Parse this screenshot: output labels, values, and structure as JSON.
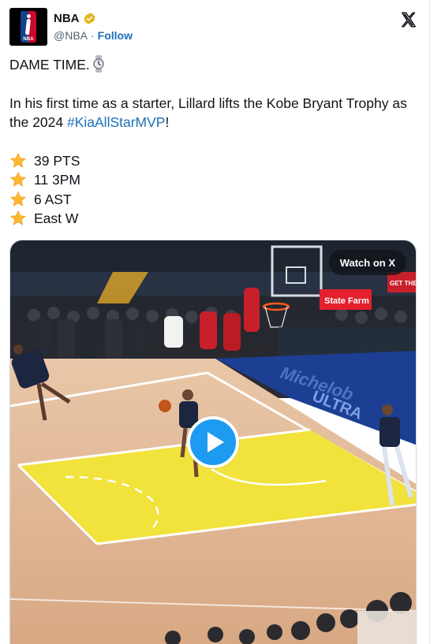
{
  "author": {
    "display_name": "NBA",
    "handle": "@NBA",
    "separator": "·",
    "follow_label": "Follow",
    "avatar_logo_text": "NBA"
  },
  "tweet": {
    "line1": "DAME TIME.",
    "line2": "In his first time as a starter, Lillard lifts the Kobe Bryant Trophy as the 2024 ",
    "hashtag": "#KiaAllStarMVP",
    "line2_end": "!",
    "stats": [
      {
        "icon": "star-emoji-icon",
        "text": "39 PTS"
      },
      {
        "icon": "star-emoji-icon",
        "text": "11 3PM"
      },
      {
        "icon": "star-emoji-icon",
        "text": "6 AST"
      },
      {
        "icon": "star-emoji-icon",
        "text": "East W"
      }
    ]
  },
  "media": {
    "watch_label": "Watch on X",
    "sponsor_label": "State Farm",
    "court_ad_text": "ULTRA",
    "banner_text": "GET THE"
  },
  "colors": {
    "link": "#1d6fb8",
    "play": "#1d9bf0",
    "court_yellow": "#f2e23c",
    "court_blue": "#1c3f94"
  }
}
